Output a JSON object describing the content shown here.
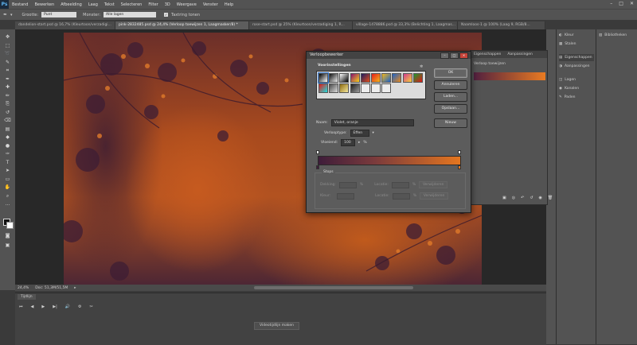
{
  "app": {
    "logo": "Ps"
  },
  "menu": [
    "Bestand",
    "Bewerken",
    "Afbeelding",
    "Laag",
    "Tekst",
    "Selecteren",
    "Filter",
    "3D",
    "Weergave",
    "Venster",
    "Help"
  ],
  "window_controls": [
    "–",
    "□",
    "✕"
  ],
  "options_bar": {
    "size_label": "Grootte:",
    "size_value": "Punt",
    "sample_label": "Monster:",
    "sample_value": "Alle lagen",
    "ring_label": "Taxtring tonen"
  },
  "doc_tabs": [
    {
      "label": "dandelion-start.psd @ 16,7% (Kleurtoon/verzadigi...",
      "active": false
    },
    {
      "label": "pink-2832485.psd @ 24,4% (Verloop toewijzen 1, Laagmasker/8) *",
      "active": true
    },
    {
      "label": "rose-start.psd @ 25% (Kleurtoon/verzadiging 1, R...",
      "active": false
    },
    {
      "label": "village-1478886.psd @ 33,3% (Belichting 1, Laagmas...",
      "active": false
    },
    {
      "label": "Naamloos-1 @ 100% (Laag 9, RGB/8...",
      "active": false
    }
  ],
  "status": {
    "zoom": "24,4%",
    "doc": "Doc: 51,3M/51,5M"
  },
  "timeline": {
    "title": "Tijdlijn",
    "make_button": "Videotijdlijn maken",
    "controls": [
      "⏮",
      "◀",
      "▶",
      "▶|",
      "🔊",
      "⚙",
      "✂"
    ]
  },
  "panel_strip": [
    {
      "label": "Kleur",
      "icon": "color-icon",
      "glyph": "◐"
    },
    {
      "label": "Stalen",
      "icon": "swatches-icon",
      "glyph": "▦"
    },
    {
      "label": "Eigenschappen",
      "icon": "properties-icon",
      "glyph": "▤",
      "selected": true
    },
    {
      "label": "Aanpassingen",
      "icon": "adjustments-icon",
      "glyph": "◑"
    },
    {
      "label": "Lagen",
      "icon": "layers-icon",
      "glyph": "◫"
    },
    {
      "label": "Kanalen",
      "icon": "channels-icon",
      "glyph": "◉"
    },
    {
      "label": "Paden",
      "icon": "paths-icon",
      "glyph": "✎"
    }
  ],
  "panel_strip2": {
    "label": "Bibliotheken",
    "icon": "libraries-icon",
    "glyph": "▥"
  },
  "bg_panel": {
    "tabs": [
      "Eigenschappen",
      "Aanpassingen"
    ],
    "title": "Verloop toewijzen",
    "icons": [
      "▣",
      "◎",
      "↶",
      "↺",
      "◉",
      "🗑"
    ]
  },
  "dialog": {
    "title": "Verloopbewerker",
    "presets_label": "Voorinstellingen",
    "buttons": [
      "OK",
      "Annuleren",
      "Laden...",
      "Opslaan..."
    ],
    "new_button": "Nieuw",
    "name_label": "Naam:",
    "name_value": "Violet, oranje",
    "type_label": "Verlooptype:",
    "type_value": "Effen",
    "smooth_label": "Vloeiend:",
    "smooth_value": "100",
    "smooth_unit": "%",
    "stops_label": "Stops",
    "opacity_label": "Dekking:",
    "opacity_unit": "%",
    "location_label": "Locatie:",
    "location_unit": "%",
    "delete_label": "Verwijderen",
    "color_label": "Kleur:",
    "gradient_colors": [
      "#3e1d3a",
      "#7b3b3c",
      "#e5761f"
    ],
    "swatch_colors": [
      [
        "#000000",
        "#ffffff"
      ],
      [
        "#111111",
        "#eeeeee"
      ],
      [
        "#ffffff",
        "#000000"
      ],
      [
        "#8a0f6e",
        "#f7d21a"
      ],
      [
        "#1c1c60",
        "#e44f1a"
      ],
      [
        "#e41c1c",
        "#f2b71c"
      ],
      [
        "#f2b71c",
        "#1d63c8"
      ],
      [
        "#1d63c8",
        "#e88a1c"
      ],
      [
        "#d23b8f",
        "#f6d23c"
      ],
      [
        "#1d9a2e",
        "#e21818"
      ],
      [
        "#e21818",
        "#1de0e0"
      ],
      [
        "#4a4a4a",
        "#dcdcdc"
      ],
      [
        "#8b6a0f",
        "#f5e79b"
      ],
      [
        "#1c1c1c",
        "#9a9a9a"
      ],
      [
        "#ededed",
        "#ededed"
      ],
      [
        "#ededed",
        "#ededed"
      ],
      [
        "#ededed",
        "#ededed"
      ]
    ]
  }
}
